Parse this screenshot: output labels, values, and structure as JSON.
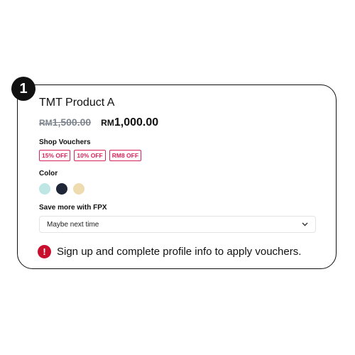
{
  "step": {
    "number": "1"
  },
  "product": {
    "name": "TMT Product A",
    "old_price": {
      "currency": "RM",
      "amount": "1,500.00"
    },
    "new_price": {
      "currency": "RM",
      "amount": "1,000.00"
    }
  },
  "vouchers": {
    "label": "Shop Vouchers",
    "items": [
      "15% OFF",
      "10% OFF",
      "RM8 OFF"
    ],
    "accent_color": "#d6245a"
  },
  "colors": {
    "label": "Color",
    "swatches": [
      "#bde6e4",
      "#1e2638",
      "#eedbb0"
    ]
  },
  "fpx": {
    "label": "Save more with FPX",
    "selected": "Maybe next time"
  },
  "notice": {
    "icon": "exclamation-icon",
    "icon_color": "#c8102e",
    "text": "Sign up and complete profile info to apply vouchers."
  }
}
